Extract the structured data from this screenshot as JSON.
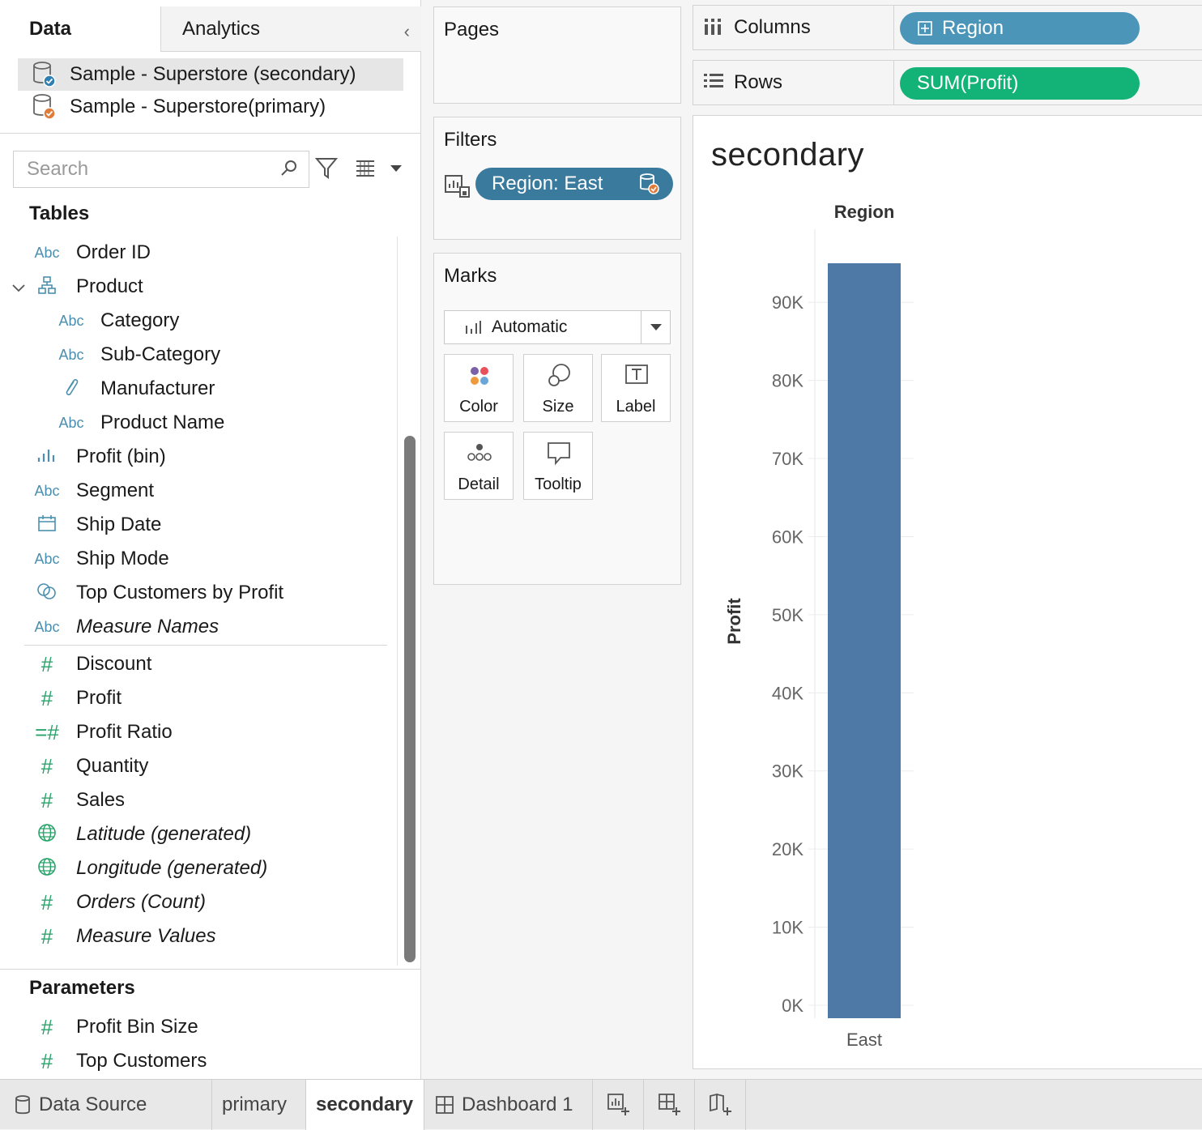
{
  "data_pane": {
    "tabs": {
      "data": "Data",
      "analytics": "Analytics"
    },
    "datasources": [
      {
        "label": "Sample - Superstore (secondary)",
        "status_color": "#2f7fb0",
        "selected": true
      },
      {
        "label": "Sample - Superstore(primary)",
        "status_color": "#e07b39",
        "selected": false
      }
    ],
    "search": {
      "placeholder": "Search"
    },
    "tables_title": "Tables",
    "dimensions": [
      {
        "label": "Order ID",
        "icon": "abc-icon",
        "indent": 0,
        "italic": false
      },
      {
        "label": "Product",
        "icon": "hierarchy-icon",
        "indent": 0,
        "italic": false,
        "expanded": true
      },
      {
        "label": "Category",
        "icon": "abc-icon",
        "indent": 1,
        "italic": false
      },
      {
        "label": "Sub-Category",
        "icon": "abc-icon",
        "indent": 1,
        "italic": false
      },
      {
        "label": "Manufacturer",
        "icon": "paperclip-icon",
        "indent": 1,
        "italic": false
      },
      {
        "label": "Product Name",
        "icon": "abc-icon",
        "indent": 1,
        "italic": false
      },
      {
        "label": "Profit (bin)",
        "icon": "bin-icon",
        "indent": 0,
        "italic": false
      },
      {
        "label": "Segment",
        "icon": "abc-icon",
        "indent": 0,
        "italic": false
      },
      {
        "label": "Ship Date",
        "icon": "calendar-icon",
        "indent": 0,
        "italic": false
      },
      {
        "label": "Ship Mode",
        "icon": "abc-icon",
        "indent": 0,
        "italic": false
      },
      {
        "label": "Top Customers by Profit",
        "icon": "set-icon",
        "indent": 0,
        "italic": false
      },
      {
        "label": "Measure Names",
        "icon": "abc-icon",
        "indent": 0,
        "italic": true
      }
    ],
    "measures": [
      {
        "label": "Discount",
        "icon": "hash-icon",
        "italic": false
      },
      {
        "label": "Profit",
        "icon": "hash-icon",
        "italic": false
      },
      {
        "label": "Profit Ratio",
        "icon": "calc-hash-icon",
        "italic": false
      },
      {
        "label": "Quantity",
        "icon": "hash-icon",
        "italic": false
      },
      {
        "label": "Sales",
        "icon": "hash-icon",
        "italic": false
      },
      {
        "label": "Latitude (generated)",
        "icon": "globe-icon",
        "italic": true
      },
      {
        "label": "Longitude (generated)",
        "icon": "globe-icon",
        "italic": true
      },
      {
        "label": "Orders (Count)",
        "icon": "hash-icon",
        "italic": true
      },
      {
        "label": "Measure Values",
        "icon": "hash-icon",
        "italic": true
      }
    ],
    "parameters_title": "Parameters",
    "parameters": [
      {
        "label": "Profit Bin Size",
        "icon": "hash-icon"
      },
      {
        "label": "Top Customers",
        "icon": "hash-icon"
      }
    ]
  },
  "shelves": {
    "pages": "Pages",
    "filters": "Filters",
    "filter_pill": "Region: East",
    "marks": "Marks",
    "mark_type": "Automatic",
    "mark_buttons": {
      "color": "Color",
      "size": "Size",
      "label": "Label",
      "detail": "Detail",
      "tooltip": "Tooltip"
    },
    "columns_label": "Columns",
    "columns_pill": "Region",
    "rows_label": "Rows",
    "rows_pill": "SUM(Profit)"
  },
  "colors": {
    "bar": "#4e79a7",
    "columns_pill": "#4a95b8",
    "rows_pill": "#13b277",
    "filter_pill": "#3a7a9d"
  },
  "view": {
    "sheet_title": "secondary"
  },
  "chart_data": {
    "type": "bar",
    "categories": [
      "East"
    ],
    "values": [
      95000
    ],
    "xlabel": "Region",
    "ylabel": "Profit",
    "ylim": [
      0,
      95000
    ],
    "yticks": [
      0,
      10000,
      20000,
      30000,
      40000,
      50000,
      60000,
      70000,
      80000,
      90000
    ],
    "ytick_labels": [
      "0K",
      "10K",
      "20K",
      "30K",
      "40K",
      "50K",
      "60K",
      "70K",
      "80K",
      "90K"
    ],
    "grid": true
  },
  "tabs": {
    "data_source": "Data Source",
    "sheets": [
      "primary",
      "secondary"
    ],
    "dashboard": "Dashboard 1",
    "active": "secondary"
  }
}
